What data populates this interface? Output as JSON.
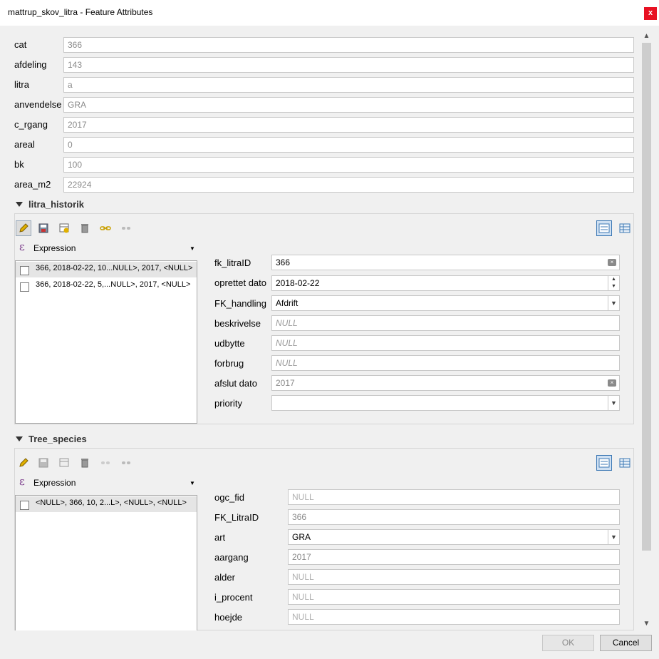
{
  "window": {
    "title": "mattrup_skov_litra - Feature Attributes",
    "close": "x"
  },
  "fields": [
    {
      "label": "cat",
      "value": "366"
    },
    {
      "label": "afdeling",
      "value": "143"
    },
    {
      "label": "litra",
      "value": "a"
    },
    {
      "label": "anvendelse",
      "value": "GRA"
    },
    {
      "label": "c_rgang",
      "value": "2017"
    },
    {
      "label": "areal",
      "value": "0"
    },
    {
      "label": "bk",
      "value": "100"
    },
    {
      "label": "area_m2",
      "value": "22924"
    }
  ],
  "litra_historik": {
    "title": "litra_historik",
    "expression_label": "Expression",
    "rows": [
      "366, 2018-02-22, 10...NULL>, 2017, <NULL>",
      "366, 2018-02-22, 5,...NULL>, 2017, <NULL>"
    ],
    "form": {
      "fk_litraID": {
        "label": "fk_litraID",
        "value": "366"
      },
      "oprettet_dato": {
        "label": "oprettet dato",
        "value": "2018-02-22"
      },
      "FK_handling": {
        "label": "FK_handling",
        "value": "Afdrift"
      },
      "beskrivelse": {
        "label": "beskrivelse",
        "value": "NULL"
      },
      "udbytte": {
        "label": "udbytte",
        "value": "NULL"
      },
      "forbrug": {
        "label": "forbrug",
        "value": "NULL"
      },
      "afslut_dato": {
        "label": "afslut dato",
        "value": "2017"
      },
      "priority": {
        "label": "priority",
        "value": ""
      }
    }
  },
  "tree_species": {
    "title": "Tree_species",
    "expression_label": "Expression",
    "rows": [
      "<NULL>, 366, 10, 2...L>, <NULL>, <NULL>"
    ],
    "form": {
      "ogc_fid": {
        "label": "ogc_fid",
        "value": "NULL"
      },
      "FK_LitraID": {
        "label": "FK_LitraID",
        "value": "366"
      },
      "art": {
        "label": "art",
        "value": "GRA"
      },
      "aargang": {
        "label": "aargang",
        "value": "2017"
      },
      "alder": {
        "label": "alder",
        "value": "NULL"
      },
      "i_procent": {
        "label": "i_procent",
        "value": "NULL"
      },
      "hoejde": {
        "label": "hoejde",
        "value": "NULL"
      }
    }
  },
  "buttons": {
    "ok": "OK",
    "cancel": "Cancel"
  },
  "colors": {
    "accent": "#3c78b4",
    "close": "#e81123",
    "null_text": "#9a9a9a"
  }
}
